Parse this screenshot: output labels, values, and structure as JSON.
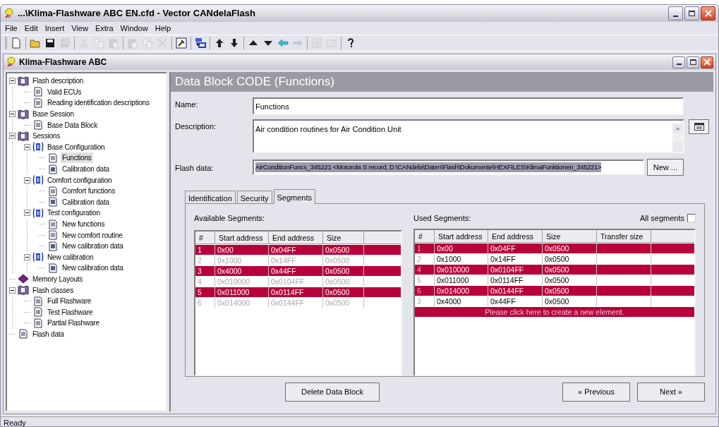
{
  "window": {
    "title": "...\\Klima-Flashware ABC EN.cfd - Vector CANdelaFlash"
  },
  "menu": [
    {
      "label": "File"
    },
    {
      "label": "Edit"
    },
    {
      "label": "Insert"
    },
    {
      "label": "View"
    },
    {
      "label": "Extra"
    },
    {
      "label": "Window"
    },
    {
      "label": "Help"
    }
  ],
  "toolbar": [
    {
      "kind": "new",
      "disabled": false
    },
    {
      "kind": "sep"
    },
    {
      "kind": "open",
      "disabled": false
    },
    {
      "kind": "save",
      "disabled": false
    },
    {
      "kind": "saveall",
      "disabled": true
    },
    {
      "kind": "sep"
    },
    {
      "kind": "cut",
      "disabled": true
    },
    {
      "kind": "copy",
      "disabled": true
    },
    {
      "kind": "paste",
      "disabled": true
    },
    {
      "kind": "sep"
    },
    {
      "kind": "paste",
      "disabled": true
    },
    {
      "kind": "copy",
      "disabled": true
    },
    {
      "kind": "delete",
      "disabled": true
    },
    {
      "kind": "sep"
    },
    {
      "kind": "build",
      "disabled": false
    },
    {
      "kind": "sep"
    },
    {
      "kind": "tree",
      "disabled": false
    },
    {
      "kind": "sep"
    },
    {
      "kind": "up",
      "disabled": false
    },
    {
      "kind": "down",
      "disabled": false
    },
    {
      "kind": "sep"
    },
    {
      "kind": "tri-up",
      "disabled": false
    },
    {
      "kind": "tri-down",
      "disabled": false
    },
    {
      "kind": "left",
      "disabled": false
    },
    {
      "kind": "right",
      "disabled": true
    },
    {
      "kind": "sep"
    },
    {
      "kind": "list",
      "disabled": true
    },
    {
      "kind": "check",
      "disabled": true
    },
    {
      "kind": "sep"
    },
    {
      "kind": "help",
      "disabled": false
    }
  ],
  "document": {
    "title": "Klima-Flashware ABC"
  },
  "tree": [
    {
      "label": "Flash description",
      "kind": "book",
      "expanded": true,
      "selected": false,
      "children": [
        {
          "label": "Valid ECUs",
          "kind": "doc",
          "selected": false
        },
        {
          "label": "Reading identification descriptions",
          "kind": "doc",
          "selected": false
        }
      ]
    },
    {
      "label": "Base Session",
      "kind": "book",
      "expanded": true,
      "selected": false,
      "children": [
        {
          "label": "Base Data Block",
          "kind": "doc",
          "selected": false
        }
      ]
    },
    {
      "label": "Sessions",
      "kind": "book",
      "expanded": true,
      "selected": false,
      "children": [
        {
          "label": "Base Configuration",
          "kind": "config",
          "expanded": true,
          "selected": false,
          "children": [
            {
              "label": "Functions",
              "kind": "doc",
              "selected": true
            },
            {
              "label": "Calibration data",
              "kind": "calib",
              "selected": false
            }
          ]
        },
        {
          "label": "Comfort configuration",
          "kind": "config",
          "expanded": true,
          "selected": false,
          "children": [
            {
              "label": "Comfort functions",
              "kind": "doc",
              "selected": false
            },
            {
              "label": "Calibration data",
              "kind": "calib",
              "selected": false
            }
          ]
        },
        {
          "label": "Test configuration",
          "kind": "config",
          "expanded": true,
          "selected": false,
          "children": [
            {
              "label": "New functions",
              "kind": "doc",
              "selected": false
            },
            {
              "label": "New comfort routine",
              "kind": "doc",
              "selected": false
            },
            {
              "label": "New calibration data",
              "kind": "calib",
              "selected": false
            }
          ]
        },
        {
          "label": "New calibration",
          "kind": "config",
          "expanded": true,
          "selected": false,
          "children": [
            {
              "label": "New calibration data",
              "kind": "calib",
              "selected": false
            }
          ]
        }
      ]
    },
    {
      "label": "Memory Layouts",
      "kind": "memory",
      "selected": false
    },
    {
      "label": "Flash classes",
      "kind": "book",
      "expanded": true,
      "selected": false,
      "children": [
        {
          "label": "Full Flashware",
          "kind": "doc",
          "selected": false
        },
        {
          "label": "Test Flashware",
          "kind": "doc",
          "selected": false
        },
        {
          "label": "Partial Flashware",
          "kind": "doc",
          "selected": false
        }
      ]
    },
    {
      "label": "Flash data",
      "kind": "doc",
      "selected": false
    }
  ],
  "panel": {
    "title": "Data Block CODE (Functions)",
    "fields": [
      {
        "kind": "text",
        "label": "Name:",
        "value": "Functions"
      },
      {
        "kind": "textarea",
        "label": "Description:",
        "value": "Air condition routines for Air Condition Unit"
      },
      {
        "kind": "select",
        "label": "Flash data:",
        "value": "AirConditionFuncs_345221 <Motorola S record, D:\\CANdela\\Daten\\Flash\\Dokumente\\HEXFILES\\KlimaFunktionen_345221>",
        "button": "New ..."
      }
    ],
    "tabs": [
      {
        "label": "Identification",
        "selected": false
      },
      {
        "label": "Security",
        "selected": false
      },
      {
        "label": "Segments",
        "selected": true
      }
    ],
    "available": {
      "label": "Available Segments:",
      "columns": [
        "#",
        "Start address",
        "End address",
        "Size"
      ],
      "rows": [
        {
          "cells": [
            "1",
            "0x00",
            "0x04FF",
            "0x0500"
          ],
          "selected": true,
          "disabled": false
        },
        {
          "cells": [
            "2",
            "0x1000",
            "0x14FF",
            "0x0500"
          ],
          "selected": false,
          "disabled": true
        },
        {
          "cells": [
            "3",
            "0x4000",
            "0x44FF",
            "0x0500"
          ],
          "selected": true,
          "disabled": false
        },
        {
          "cells": [
            "4",
            "0x010000",
            "0x0104FF",
            "0x0500"
          ],
          "selected": false,
          "disabled": true
        },
        {
          "cells": [
            "5",
            "0x011000",
            "0x0114FF",
            "0x0500"
          ],
          "selected": true,
          "disabled": false
        },
        {
          "cells": [
            "6",
            "0x014000",
            "0x0144FF",
            "0x0500"
          ],
          "selected": false,
          "disabled": true
        }
      ]
    },
    "used": {
      "label": "Used Segments:",
      "all_segments": {
        "label": "All segments",
        "checked": false
      },
      "columns": [
        "#",
        "Start address",
        "End address",
        "Size",
        "Transfer size"
      ],
      "rows": [
        {
          "cells": [
            "1",
            "0x00",
            "0x04FF",
            "0x0500"
          ],
          "selected": true
        },
        {
          "cells": [
            "2",
            "0x1000",
            "0x14FF",
            "0x0500"
          ],
          "selected": false
        },
        {
          "cells": [
            "4",
            "0x010000",
            "0x0104FF",
            "0x0500"
          ],
          "selected": true
        },
        {
          "cells": [
            "5",
            "0x011000",
            "0x0114FF",
            "0x0500"
          ],
          "selected": false
        },
        {
          "cells": [
            "6",
            "0x014000",
            "0x0144FF",
            "0x0500"
          ],
          "selected": true
        },
        {
          "cells": [
            "3",
            "0x4000",
            "0x44FF",
            "0x0500"
          ],
          "selected": false
        }
      ],
      "new_row": "Please click here to create a new element."
    },
    "buttons": [
      {
        "kind": "left",
        "label": "Delete Data Block"
      },
      {
        "kind": "right",
        "label": "« Previous"
      },
      {
        "kind": "right",
        "label": "Next »"
      }
    ]
  },
  "status_bar": "Ready"
}
